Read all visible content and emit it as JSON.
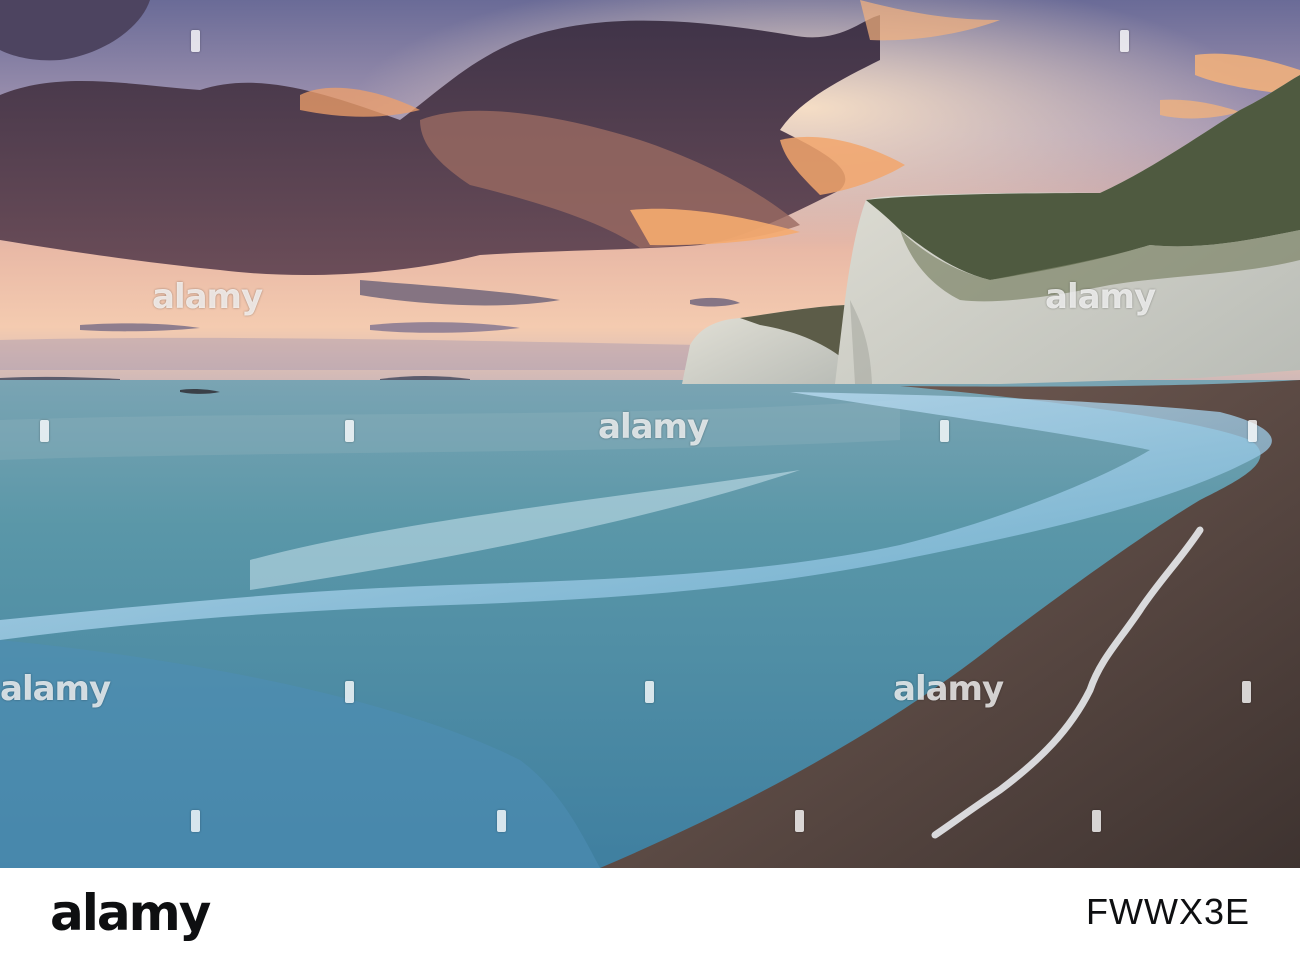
{
  "scene": {
    "kind": "seascape-sunset-photo",
    "colors": {
      "sky_top": "#6c6c98",
      "sky_glow": "#f7c9a6",
      "cloud_dark": "#4a3a52",
      "cloud_lit": "#f0a06a",
      "sea": "#5e9aa8",
      "surf": "#cfe6f3",
      "beach": "#5a4a40",
      "cliff": "#d9d9cf"
    }
  },
  "watermarks": [
    "alamy",
    "alamy",
    "alamy",
    "alamy",
    "alamy",
    "alamy"
  ],
  "footer": {
    "logo": "alamy",
    "image_id": "FWWX3E"
  }
}
